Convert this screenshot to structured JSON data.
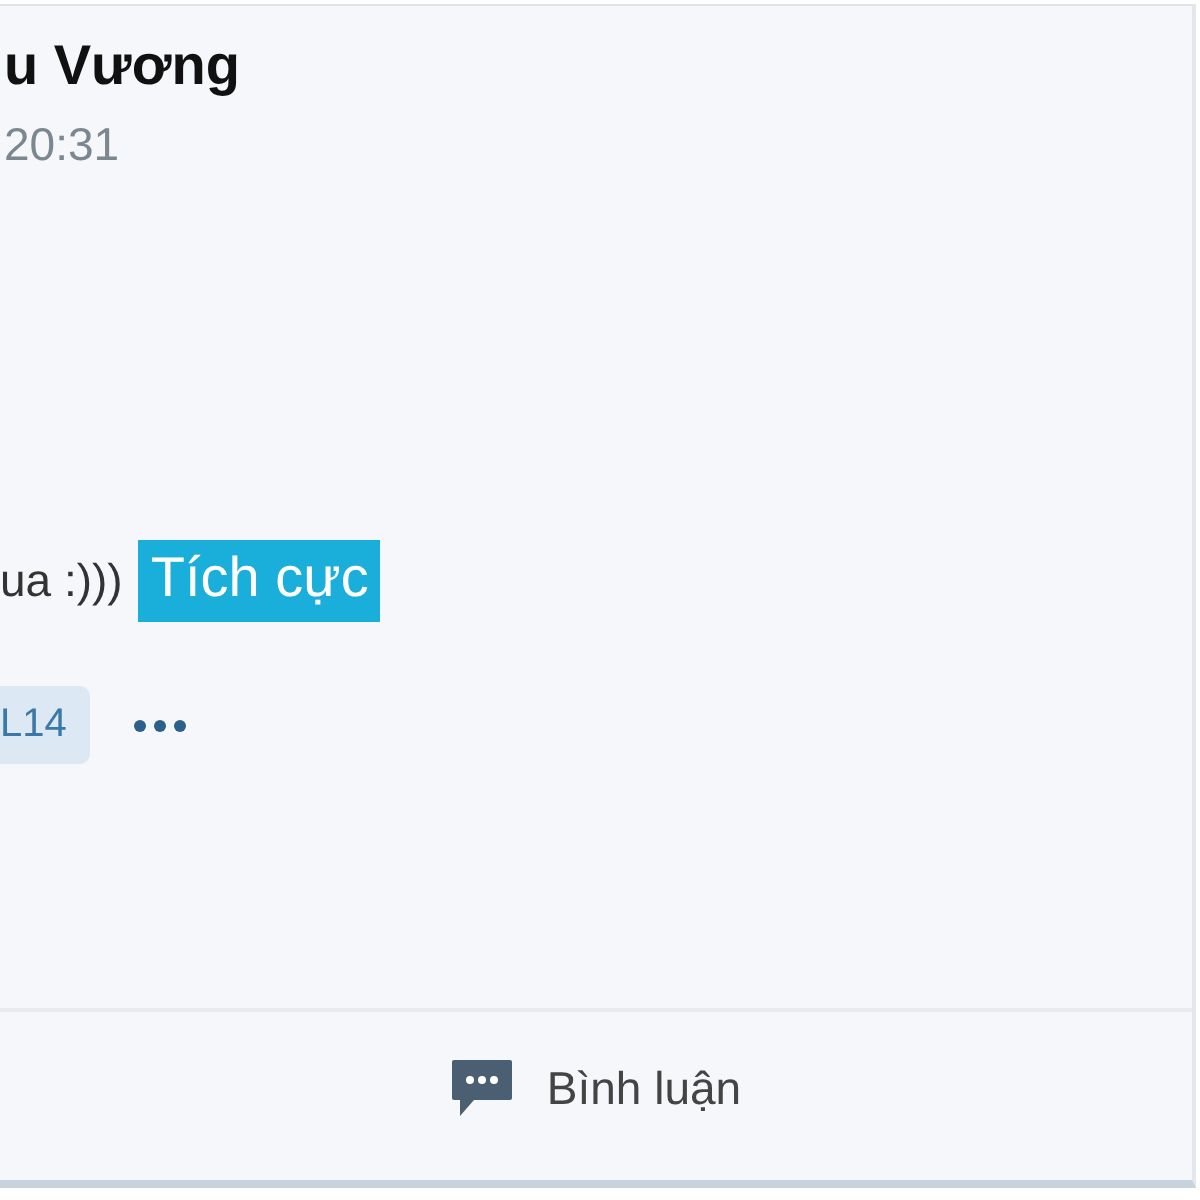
{
  "post": {
    "author": "u Vương",
    "time": "20:31",
    "content": "ua :)))",
    "sentiment": {
      "label": "Tích cực",
      "kind": "positive"
    },
    "tags": [
      "L14"
    ],
    "actions": [
      {
        "label": "Bình luận",
        "kind": "comment"
      }
    ]
  }
}
